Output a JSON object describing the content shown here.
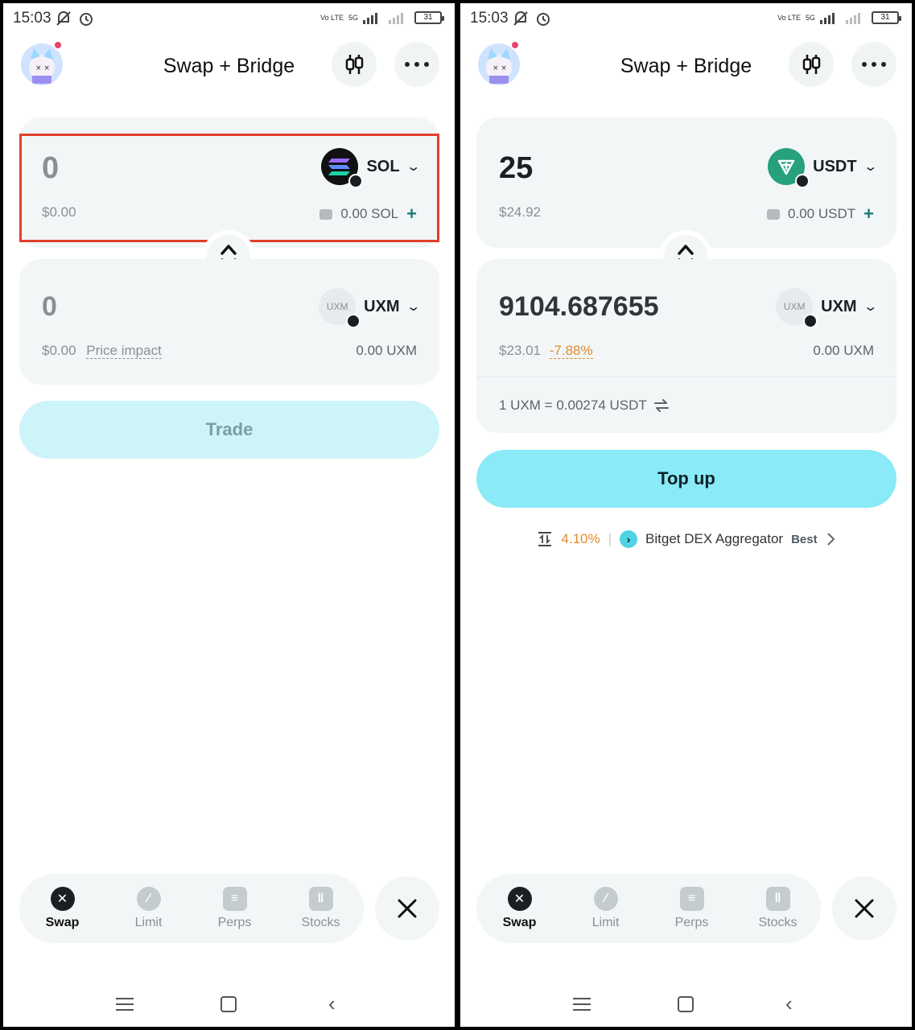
{
  "status_bar": {
    "time": "15:03",
    "net": "5G",
    "volte": "Vo LTE",
    "battery": "31"
  },
  "left": {
    "title": "Swap + Bridge",
    "from": {
      "amount": "0",
      "usd": "$0.00",
      "token": "SOL",
      "balance": "0.00 SOL"
    },
    "to": {
      "amount": "0",
      "usd": "$0.00",
      "price_impact_label": "Price impact",
      "token": "UXM",
      "balance": "0.00 UXM"
    },
    "action_button": "Trade",
    "nav": {
      "swap": "Swap",
      "limit": "Limit",
      "perps": "Perps",
      "stocks": "Stocks"
    }
  },
  "right": {
    "title": "Swap + Bridge",
    "from": {
      "amount": "25",
      "usd": "$24.92",
      "token": "USDT",
      "balance": "0.00 USDT"
    },
    "to": {
      "amount": "9104.687655",
      "usd": "$23.01",
      "price_impact": "-7.88%",
      "token": "UXM",
      "balance": "0.00 UXM"
    },
    "rate": "1 UXM = 0.00274 USDT",
    "action_button": "Top up",
    "route": {
      "slippage": "4.10%",
      "aggregator": "Bitget DEX Aggregator",
      "badge": "Best"
    },
    "nav": {
      "swap": "Swap",
      "limit": "Limit",
      "perps": "Perps",
      "stocks": "Stocks"
    }
  },
  "icons": {
    "token_logo_uxm": "UXM"
  },
  "colors": {
    "accent_button": "#8aeaf7",
    "disabled_button": "#cdf4f9",
    "highlight_border": "#e0402b",
    "price_impact": "#e38a2c"
  }
}
